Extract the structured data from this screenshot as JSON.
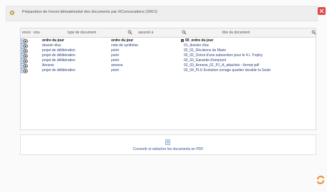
{
  "dialog": {
    "title": "Préparation de l'envoi dématérialisé des documents par iXConvocations (SRCI)"
  },
  "table": {
    "headers": {
      "envoi": "envoi",
      "visu": "visu",
      "type": "type de document",
      "assoc": "associé à",
      "titre": "titre du document"
    },
    "rows": [
      {
        "type": "ordre du jour",
        "assoc": "ordre du jour",
        "titre": "00_ordre du jour",
        "bold": true
      },
      {
        "type": "dossier élus",
        "assoc": "note de synthèse",
        "titre": "01_dossier élus"
      },
      {
        "type": "projet de délibération",
        "assoc": "point",
        "titre": "02_01_Décisions du Maire"
      },
      {
        "type": "projet de délibération",
        "assoc": "point",
        "titre": "02_02_Octroi d'une subvention pour le 4 L Trophy"
      },
      {
        "type": "projet de délibération",
        "assoc": "point",
        "titre": "02_03_Garantie d'emprunt"
      },
      {
        "type": "Annexe",
        "assoc": "annexe",
        "titre": "02_03_Annexe_01_PJ_A_attachée - format pdf"
      },
      {
        "type": "projet de délibération",
        "assoc": "point",
        "titre": "02_04_PLU Evolution zonage quartier durable la Soule"
      }
    ]
  },
  "convert": {
    "label": "Convertir et rattacher les documents en PDF"
  },
  "icons": {
    "title": "gear-icon",
    "close": "close-icon",
    "search": "magnifier-icon",
    "document": "document-icon",
    "refresh": "refresh-icon"
  },
  "colors": {
    "close": "#e04848",
    "link": "#2a3f7a",
    "refresh": "#f0923a"
  }
}
